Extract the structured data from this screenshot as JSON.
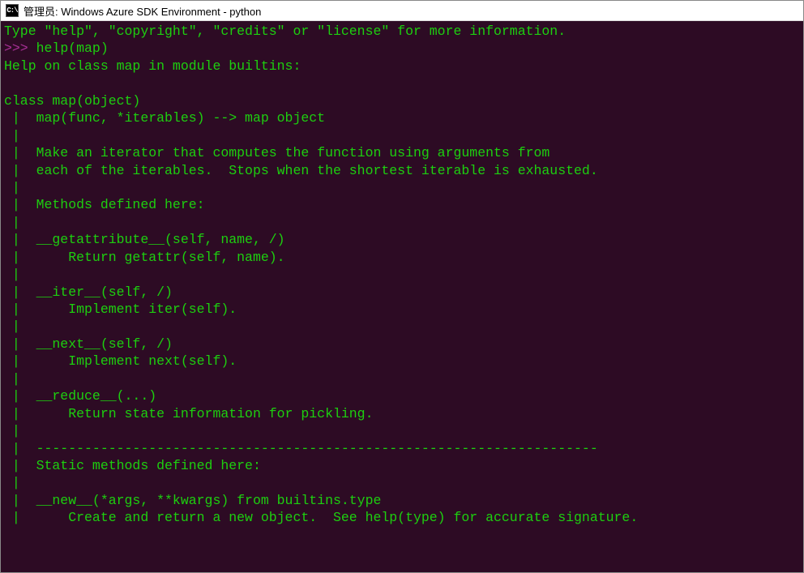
{
  "titlebar": {
    "icon_label": "C:\\",
    "title": "管理员:  Windows Azure SDK Environment - python"
  },
  "terminal": {
    "intro": "Type \"help\", \"copyright\", \"credits\" or \"license\" for more information.",
    "prompt": ">>> ",
    "command": "help(map)",
    "output_lines": [
      "Help on class map in module builtins:",
      "",
      "class map(object)",
      " |  map(func, *iterables) --> map object",
      " |",
      " |  Make an iterator that computes the function using arguments from",
      " |  each of the iterables.  Stops when the shortest iterable is exhausted.",
      " |",
      " |  Methods defined here:",
      " |",
      " |  __getattribute__(self, name, /)",
      " |      Return getattr(self, name).",
      " |",
      " |  __iter__(self, /)",
      " |      Implement iter(self).",
      " |",
      " |  __next__(self, /)",
      " |      Implement next(self).",
      " |",
      " |  __reduce__(...)",
      " |      Return state information for pickling.",
      " |",
      " |  ----------------------------------------------------------------------",
      " |  Static methods defined here:",
      " |",
      " |  __new__(*args, **kwargs) from builtins.type",
      " |      Create and return a new object.  See help(type) for accurate signature."
    ]
  }
}
